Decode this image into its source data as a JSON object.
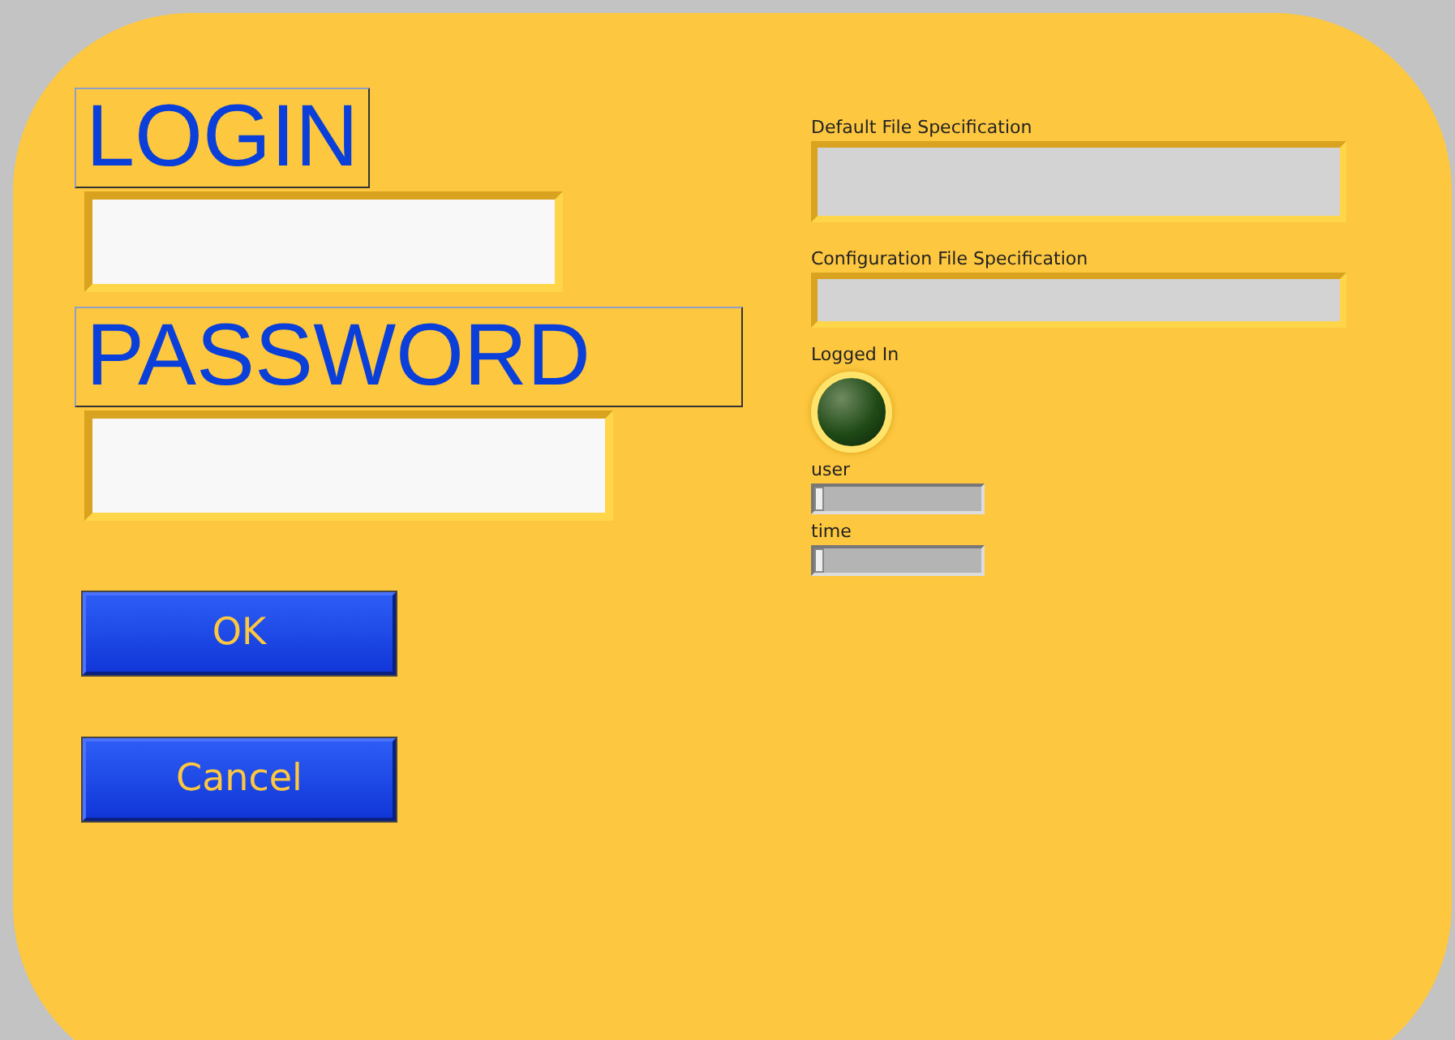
{
  "login": {
    "label": "LOGIN"
  },
  "password": {
    "label": "PASSWORD"
  },
  "buttons": [
    {
      "label": "OK"
    },
    {
      "label": "Cancel"
    }
  ],
  "default_file": {
    "label": "Default File Specification"
  },
  "config_file": {
    "label": "Configuration File Specification"
  },
  "logged_in": {
    "label": "Logged In",
    "on": false
  },
  "sliders": [
    {
      "label": "user",
      "level": 0
    },
    {
      "label": "time",
      "level": 0
    }
  ]
}
